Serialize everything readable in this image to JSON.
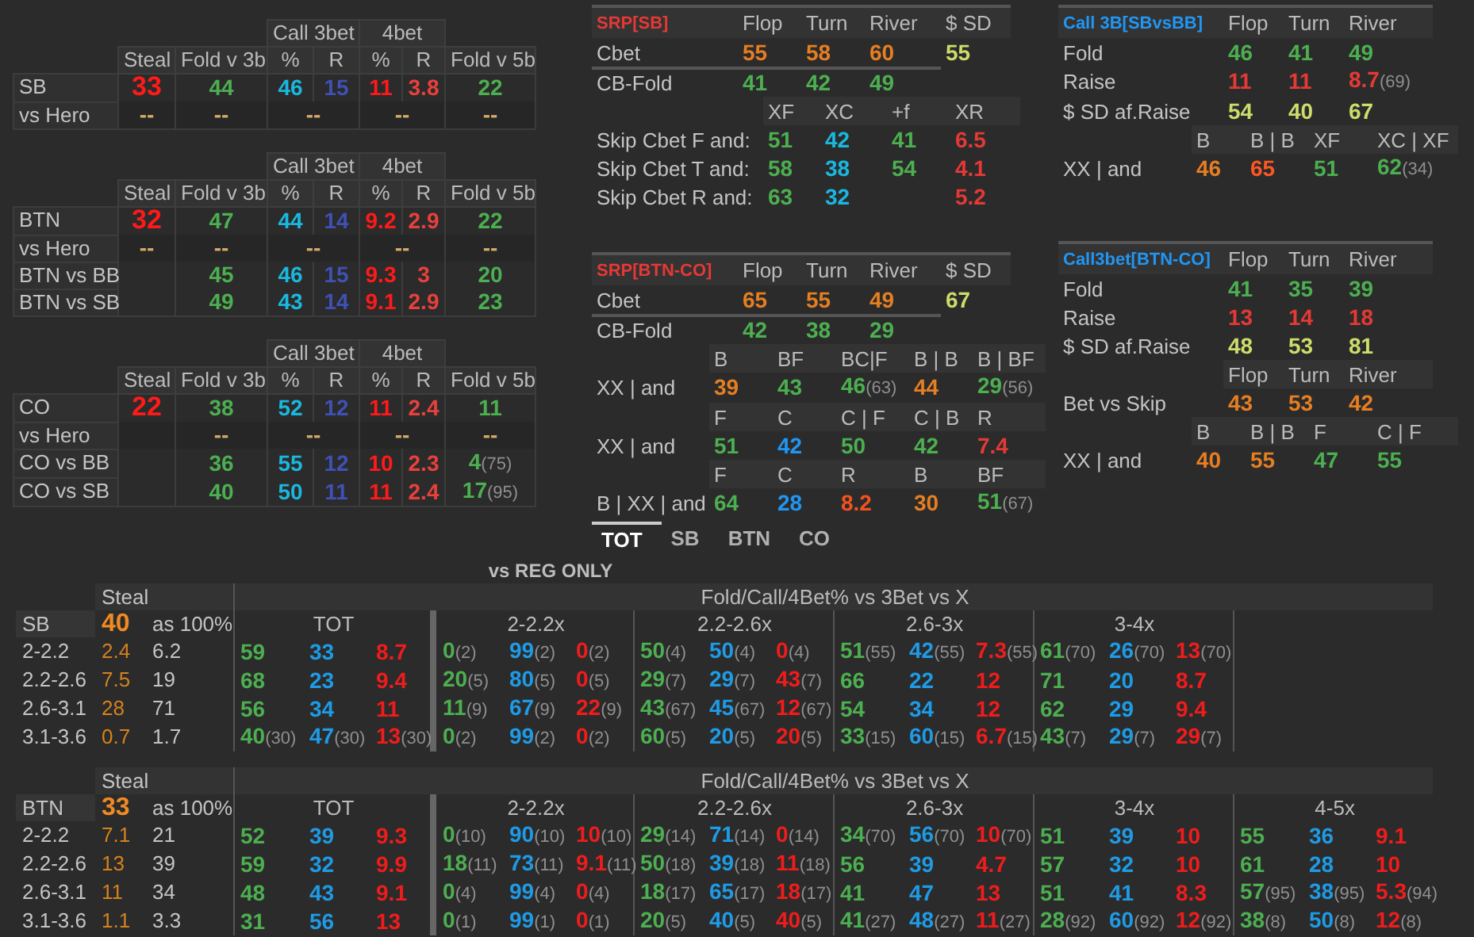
{
  "position_tables": [
    {
      "group_headers": [
        "Call 3bet",
        "4bet"
      ],
      "columns": [
        "Steal",
        "Fold v 3b",
        "%",
        "R",
        "%",
        "R",
        "Fold v 5b"
      ],
      "rows": [
        {
          "label": "SB",
          "kind": "full",
          "cells": [
            {
              "value": "33",
              "color": "#ff1a1a"
            },
            {
              "value": "44",
              "color": "#4caf50"
            },
            {
              "value": "46",
              "color": "#1ab8e0"
            },
            {
              "value": "15",
              "color": "#3f51b5"
            },
            {
              "value": "11",
              "color": "#ff1a1a"
            },
            {
              "value": "3.8",
              "color": "#e8403c"
            },
            {
              "value": "22",
              "color": "#4caf50"
            }
          ]
        },
        {
          "label": "vs Hero",
          "kind": "merged",
          "cells": [
            {
              "value": "--",
              "color": "#d4a96a"
            },
            {
              "value": "--",
              "color": "#d4a96a"
            },
            {
              "value": "--",
              "color": "#d4a96a",
              "colspan": 2
            },
            {
              "value": "--",
              "color": "#d4a96a",
              "colspan": 2
            },
            {
              "value": "--",
              "color": "#d4a96a"
            }
          ]
        }
      ]
    },
    {
      "group_headers": [
        "Call 3bet",
        "4bet"
      ],
      "columns": [
        "Steal",
        "Fold v 3b",
        "%",
        "R",
        "%",
        "R",
        "Fold v 5b"
      ],
      "rows": [
        {
          "label": "BTN",
          "kind": "full",
          "cells": [
            {
              "value": "32",
              "color": "#ff1a1a"
            },
            {
              "value": "47",
              "color": "#4caf50"
            },
            {
              "value": "44",
              "color": "#1ab8e0"
            },
            {
              "value": "14",
              "color": "#3f51b5"
            },
            {
              "value": "9.2",
              "color": "#ff1a1a"
            },
            {
              "value": "2.9",
              "color": "#e8403c"
            },
            {
              "value": "22",
              "color": "#4caf50"
            }
          ]
        },
        {
          "label": "vs Hero",
          "kind": "merged",
          "cells": [
            {
              "value": "--",
              "color": "#d4a96a"
            },
            {
              "value": "--",
              "color": "#d4a96a"
            },
            {
              "value": "--",
              "color": "#d4a96a",
              "colspan": 2
            },
            {
              "value": "--",
              "color": "#d4a96a",
              "colspan": 2
            },
            {
              "value": "--",
              "color": "#d4a96a"
            }
          ]
        },
        {
          "label": "BTN vs BB",
          "kind": "full",
          "cells": [
            null,
            {
              "value": "45",
              "color": "#4caf50"
            },
            {
              "value": "46",
              "color": "#1ab8e0"
            },
            {
              "value": "15",
              "color": "#3f51b5"
            },
            {
              "value": "9.3",
              "color": "#ff1a1a"
            },
            {
              "value": "3",
              "color": "#e8403c"
            },
            {
              "value": "20",
              "color": "#4caf50"
            }
          ]
        },
        {
          "label": "BTN vs SB",
          "kind": "full",
          "cells": [
            null,
            {
              "value": "49",
              "color": "#4caf50"
            },
            {
              "value": "43",
              "color": "#1ab8e0"
            },
            {
              "value": "14",
              "color": "#3f51b5"
            },
            {
              "value": "9.1",
              "color": "#ff1a1a"
            },
            {
              "value": "2.9",
              "color": "#e8403c"
            },
            {
              "value": "23",
              "color": "#4caf50"
            }
          ]
        }
      ]
    },
    {
      "group_headers": [
        "Call 3bet",
        "4bet"
      ],
      "columns": [
        "Steal",
        "Fold v 3b",
        "%",
        "R",
        "%",
        "R",
        "Fold v 5b"
      ],
      "rows": [
        {
          "label": "CO",
          "kind": "full",
          "cells": [
            {
              "value": "22",
              "color": "#ff1a1a"
            },
            {
              "value": "38",
              "color": "#4caf50"
            },
            {
              "value": "52",
              "color": "#1ab8e0"
            },
            {
              "value": "12",
              "color": "#3f51b5"
            },
            {
              "value": "11",
              "color": "#ff1a1a"
            },
            {
              "value": "2.4",
              "color": "#e8403c"
            },
            {
              "value": "11",
              "color": "#4caf50"
            }
          ]
        },
        {
          "label": "vs Hero",
          "kind": "merged",
          "cells": [
            null,
            {
              "value": "--",
              "color": "#d4a96a"
            },
            {
              "value": "--",
              "color": "#d4a96a",
              "colspan": 2
            },
            {
              "value": "--",
              "color": "#d4a96a",
              "colspan": 2
            },
            {
              "value": "--",
              "color": "#d4a96a"
            }
          ]
        },
        {
          "label": "CO vs BB",
          "kind": "full",
          "cells": [
            null,
            {
              "value": "36",
              "color": "#4caf50"
            },
            {
              "value": "55",
              "color": "#1ab8e0"
            },
            {
              "value": "12",
              "color": "#3f51b5"
            },
            {
              "value": "10",
              "color": "#ff1a1a"
            },
            {
              "value": "2.3",
              "color": "#e8403c"
            },
            {
              "value": "4",
              "sample": "(75)",
              "color": "#4caf50"
            }
          ]
        },
        {
          "label": "CO vs SB",
          "kind": "full",
          "cells": [
            null,
            {
              "value": "40",
              "color": "#4caf50"
            },
            {
              "value": "50",
              "color": "#1ab8e0"
            },
            {
              "value": "11",
              "color": "#3f51b5"
            },
            {
              "value": "11",
              "color": "#ff1a1a"
            },
            {
              "value": "2.4",
              "color": "#e8403c"
            },
            {
              "value": "17",
              "sample": "(95)",
              "color": "#4caf50"
            }
          ]
        }
      ]
    }
  ],
  "middle_panels": [
    {
      "title": "SRP[SB]",
      "color": "#e53935",
      "blocks": [
        {
          "kind": "main",
          "header": [
            "Flop",
            "Turn",
            "River",
            "$ SD"
          ],
          "rows": [
            {
              "label": "Cbet",
              "cells": [
                {
                  "value": "55",
                  "color": "#e67e22"
                },
                {
                  "value": "58",
                  "color": "#e67e22"
                },
                {
                  "value": "60",
                  "color": "#e67e22"
                },
                {
                  "value": "55",
                  "color": "#cddc6a"
                }
              ]
            }
          ]
        },
        {
          "kind": "main",
          "rows": [
            {
              "label": "CB-Fold",
              "cells": [
                {
                  "value": "41",
                  "color": "#4caf50"
                },
                {
                  "value": "42",
                  "color": "#4caf50"
                },
                {
                  "value": "49",
                  "color": "#4caf50"
                }
              ]
            }
          ]
        },
        {
          "kind": "wide",
          "header": [
            "XF",
            "XC",
            "+f",
            "XR"
          ],
          "rows": [
            {
              "label": "Skip Cbet F and:",
              "cells": [
                {
                  "value": "51",
                  "color": "#4caf50"
                },
                {
                  "value": "42",
                  "color": "#1ab8e0"
                },
                {
                  "value": "41",
                  "color": "#4caf50"
                },
                {
                  "value": "6.5",
                  "color": "#e53935"
                }
              ]
            },
            {
              "label": "Skip Cbet T and:",
              "cells": [
                {
                  "value": "58",
                  "color": "#4caf50"
                },
                {
                  "value": "38",
                  "color": "#1ab8e0"
                },
                {
                  "value": "54",
                  "color": "#4caf50"
                },
                {
                  "value": "4.1",
                  "color": "#e53935"
                }
              ]
            },
            {
              "label": "Skip Cbet R and:",
              "cells": [
                {
                  "value": "63",
                  "color": "#4caf50"
                },
                {
                  "value": "32",
                  "color": "#1ab8e0"
                },
                null,
                {
                  "value": "5.2",
                  "color": "#e53935"
                }
              ]
            }
          ]
        }
      ]
    },
    {
      "title": "SRP[BTN-CO]",
      "color": "#e53935",
      "blocks": [
        {
          "kind": "main",
          "header": [
            "Flop",
            "Turn",
            "River",
            "$ SD"
          ],
          "rows": [
            {
              "label": "Cbet",
              "cells": [
                {
                  "value": "65",
                  "color": "#e67e22"
                },
                {
                  "value": "55",
                  "color": "#e67e22"
                },
                {
                  "value": "49",
                  "color": "#e67e22"
                },
                {
                  "value": "67",
                  "color": "#cddc6a"
                }
              ]
            }
          ]
        },
        {
          "kind": "main",
          "rows": [
            {
              "label": "CB-Fold",
              "cells": [
                {
                  "value": "42",
                  "color": "#4caf50"
                },
                {
                  "value": "38",
                  "color": "#4caf50"
                },
                {
                  "value": "29",
                  "color": "#4caf50"
                }
              ]
            }
          ]
        },
        {
          "kind": "grid",
          "header": [
            "B",
            "BF",
            "BC|F",
            "B | B",
            "B | BF"
          ],
          "rows": [
            {
              "label": "XX | and",
              "cells": [
                {
                  "value": "39",
                  "color": "#e67e22"
                },
                {
                  "value": "43",
                  "color": "#4caf50"
                },
                {
                  "value": "46",
                  "sample": "(63)",
                  "color": "#4caf50"
                },
                {
                  "value": "44",
                  "color": "#e67e22"
                },
                {
                  "value": "29",
                  "sample": "(56)",
                  "color": "#4caf50"
                }
              ]
            }
          ]
        },
        {
          "kind": "grid",
          "header": [
            "F",
            "C",
            "C | F",
            "C | B",
            "R"
          ],
          "rows": [
            {
              "label": "XX | and",
              "cells": [
                {
                  "value": "51",
                  "color": "#4caf50"
                },
                {
                  "value": "42",
                  "color": "#2196f3"
                },
                {
                  "value": "50",
                  "color": "#4caf50"
                },
                {
                  "value": "42",
                  "color": "#4caf50"
                },
                {
                  "value": "7.4",
                  "color": "#e53935"
                }
              ]
            }
          ]
        },
        {
          "kind": "grid",
          "header": [
            "F",
            "C",
            "R",
            "B",
            "BF"
          ],
          "rows": [
            {
              "label": "B | XX | and",
              "cells": [
                {
                  "value": "64",
                  "color": "#4caf50"
                },
                {
                  "value": "28",
                  "color": "#2196f3"
                },
                {
                  "value": "8.2",
                  "color": "#f4511e"
                },
                {
                  "value": "30",
                  "color": "#e67e22"
                },
                {
                  "value": "51",
                  "sample": "(67)",
                  "color": "#4caf50"
                }
              ]
            }
          ]
        }
      ]
    }
  ],
  "tabs": [
    {
      "label": "TOT",
      "selected": true
    },
    {
      "label": "SB",
      "selected": false
    },
    {
      "label": "BTN",
      "selected": false
    },
    {
      "label": "CO",
      "selected": false
    }
  ],
  "right_panels": [
    {
      "title": "Call 3B[SBvsBB]",
      "color": "#2196f3",
      "blocks": [
        {
          "kind": "main",
          "header": [
            "Flop",
            "Turn",
            "River"
          ],
          "rows": [
            {
              "label": "Fold",
              "cells": [
                {
                  "value": "46",
                  "color": "#4caf50"
                },
                {
                  "value": "41",
                  "color": "#4caf50"
                },
                {
                  "value": "49",
                  "color": "#4caf50"
                }
              ]
            },
            {
              "label": "Raise",
              "cells": [
                {
                  "value": "11",
                  "color": "#e53935"
                },
                {
                  "value": "11",
                  "color": "#e53935"
                },
                {
                  "value": "8.7",
                  "sample": "(69)",
                  "color": "#e53935"
                }
              ]
            },
            {
              "label": "$ SD af.Raise",
              "cells": [
                {
                  "value": "54",
                  "color": "#cddc6a"
                },
                {
                  "value": "40",
                  "color": "#cddc6a"
                },
                {
                  "value": "67",
                  "color": "#cddc6a"
                }
              ]
            }
          ]
        },
        {
          "kind": "grid",
          "header": [
            "B",
            "B | B",
            "XF",
            "XC | XF"
          ],
          "rows": [
            {
              "label": "XX | and",
              "cells": [
                {
                  "value": "46",
                  "color": "#e67e22"
                },
                {
                  "value": "65",
                  "color": "#ff5722"
                },
                {
                  "value": "51",
                  "color": "#4caf50"
                },
                {
                  "value": "62",
                  "sample": "(34)",
                  "color": "#4caf50"
                }
              ]
            }
          ]
        }
      ]
    },
    {
      "title": "Call3bet[BTN-CO]",
      "color": "#2196f3",
      "blocks": [
        {
          "kind": "main",
          "header": [
            "Flop",
            "Turn",
            "River"
          ],
          "rows": [
            {
              "label": "Fold",
              "cells": [
                {
                  "value": "41",
                  "color": "#4caf50"
                },
                {
                  "value": "35",
                  "color": "#4caf50"
                },
                {
                  "value": "39",
                  "color": "#4caf50"
                }
              ]
            },
            {
              "label": "Raise",
              "cells": [
                {
                  "value": "13",
                  "color": "#e53935"
                },
                {
                  "value": "14",
                  "color": "#e53935"
                },
                {
                  "value": "18",
                  "color": "#e53935"
                }
              ]
            },
            {
              "label": "$ SD af.Raise",
              "cells": [
                {
                  "value": "48",
                  "color": "#cddc6a"
                },
                {
                  "value": "53",
                  "color": "#cddc6a"
                },
                {
                  "value": "81",
                  "color": "#cddc6a"
                }
              ]
            }
          ]
        },
        {
          "kind": "main",
          "header": [
            "Flop",
            "Turn",
            "River"
          ],
          "rows": [
            {
              "label": "Bet vs Skip",
              "cells": [
                {
                  "value": "43",
                  "color": "#e67e22"
                },
                {
                  "value": "53",
                  "color": "#e67e22"
                },
                {
                  "value": "42",
                  "color": "#e67e22"
                }
              ]
            }
          ]
        },
        {
          "kind": "grid",
          "header": [
            "B",
            "B | B",
            "F",
            "C | F"
          ],
          "rows": [
            {
              "label": "XX | and",
              "cells": [
                {
                  "value": "40",
                  "color": "#e67e22"
                },
                {
                  "value": "55",
                  "color": "#e67e22"
                },
                {
                  "value": "47",
                  "color": "#4caf50"
                },
                {
                  "value": "55",
                  "color": "#4caf50"
                }
              ]
            }
          ]
        }
      ]
    }
  ],
  "reg_section": {
    "title": "vs REG ONLY",
    "blocks": [
      {
        "position": "SB",
        "steal_header": "Steal",
        "steal": "40",
        "as100": "as 100%",
        "header": "Fold/Call/4Bet% vs 3Bet vs X",
        "groups": [
          "TOT",
          "2-2.2x",
          "2.2-2.6x",
          "2.6-3x",
          "3-4x"
        ],
        "rows": [
          {
            "label": "2-2.2",
            "steal": "2.4",
            "as100": "6.2",
            "cells": [
              [
                "59"
              ],
              [
                "33"
              ],
              [
                "8.7"
              ],
              [
                "0",
                "(2)"
              ],
              [
                "99",
                "(2)"
              ],
              [
                "0",
                "(2)"
              ],
              [
                "50",
                "(4)"
              ],
              [
                "50",
                "(4)"
              ],
              [
                "0",
                "(4)"
              ],
              [
                "51",
                "(55)"
              ],
              [
                "42",
                "(55)"
              ],
              [
                "7.3",
                "(55)"
              ],
              [
                "61",
                "(70)"
              ],
              [
                "26",
                "(70)"
              ],
              [
                "13",
                "(70)"
              ]
            ]
          },
          {
            "label": "2.2-2.6",
            "steal": "7.5",
            "as100": "19",
            "cells": [
              [
                "68"
              ],
              [
                "23"
              ],
              [
                "9.4"
              ],
              [
                "20",
                "(5)"
              ],
              [
                "80",
                "(5)"
              ],
              [
                "0",
                "(5)"
              ],
              [
                "29",
                "(7)"
              ],
              [
                "29",
                "(7)"
              ],
              [
                "43",
                "(7)"
              ],
              [
                "66"
              ],
              [
                "22"
              ],
              [
                "12"
              ],
              [
                "71"
              ],
              [
                "20"
              ],
              [
                "8.7"
              ]
            ]
          },
          {
            "label": "2.6-3.1",
            "steal": "28",
            "as100": "71",
            "cells": [
              [
                "56"
              ],
              [
                "34"
              ],
              [
                "11"
              ],
              [
                "11",
                "(9)"
              ],
              [
                "67",
                "(9)"
              ],
              [
                "22",
                "(9)"
              ],
              [
                "43",
                "(67)"
              ],
              [
                "45",
                "(67)"
              ],
              [
                "12",
                "(67)"
              ],
              [
                "54"
              ],
              [
                "34"
              ],
              [
                "12"
              ],
              [
                "62"
              ],
              [
                "29"
              ],
              [
                "9.4"
              ]
            ]
          },
          {
            "label": "3.1-3.6",
            "steal": "0.7",
            "as100": "1.7",
            "cells": [
              [
                "40",
                "(30)"
              ],
              [
                "47",
                "(30)"
              ],
              [
                "13",
                "(30)"
              ],
              [
                "0",
                "(2)"
              ],
              [
                "99",
                "(2)"
              ],
              [
                "0",
                "(2)"
              ],
              [
                "60",
                "(5)"
              ],
              [
                "20",
                "(5)"
              ],
              [
                "20",
                "(5)"
              ],
              [
                "33",
                "(15)"
              ],
              [
                "60",
                "(15)"
              ],
              [
                "6.7",
                "(15)"
              ],
              [
                "43",
                "(7)"
              ],
              [
                "29",
                "(7)"
              ],
              [
                "29",
                "(7)"
              ]
            ]
          }
        ]
      },
      {
        "position": "BTN",
        "steal_header": "Steal",
        "steal": "33",
        "as100": "as 100%",
        "header": "Fold/Call/4Bet% vs 3Bet vs X",
        "groups": [
          "TOT",
          "2-2.2x",
          "2.2-2.6x",
          "2.6-3x",
          "3-4x",
          "4-5x"
        ],
        "rows": [
          {
            "label": "2-2.2",
            "steal": "7.1",
            "as100": "21",
            "cells": [
              [
                "52"
              ],
              [
                "39"
              ],
              [
                "9.3"
              ],
              [
                "0",
                "(10)"
              ],
              [
                "90",
                "(10)"
              ],
              [
                "10",
                "(10)"
              ],
              [
                "29",
                "(14)"
              ],
              [
                "71",
                "(14)"
              ],
              [
                "0",
                "(14)"
              ],
              [
                "34",
                "(70)"
              ],
              [
                "56",
                "(70)"
              ],
              [
                "10",
                "(70)"
              ],
              [
                "51"
              ],
              [
                "39"
              ],
              [
                "10"
              ],
              [
                "55"
              ],
              [
                "36"
              ],
              [
                "9.1"
              ]
            ]
          },
          {
            "label": "2.2-2.6",
            "steal": "13",
            "as100": "39",
            "cells": [
              [
                "59"
              ],
              [
                "32"
              ],
              [
                "9.9"
              ],
              [
                "18",
                "(11)"
              ],
              [
                "73",
                "(11)"
              ],
              [
                "9.1",
                "(11)"
              ],
              [
                "50",
                "(18)"
              ],
              [
                "39",
                "(18)"
              ],
              [
                "11",
                "(18)"
              ],
              [
                "56"
              ],
              [
                "39"
              ],
              [
                "4.7"
              ],
              [
                "57"
              ],
              [
                "32"
              ],
              [
                "10"
              ],
              [
                "61"
              ],
              [
                "28"
              ],
              [
                "10"
              ]
            ]
          },
          {
            "label": "2.6-3.1",
            "steal": "11",
            "as100": "34",
            "cells": [
              [
                "48"
              ],
              [
                "43"
              ],
              [
                "9.1"
              ],
              [
                "0",
                "(4)"
              ],
              [
                "99",
                "(4)"
              ],
              [
                "0",
                "(4)"
              ],
              [
                "18",
                "(17)"
              ],
              [
                "65",
                "(17)"
              ],
              [
                "18",
                "(17)"
              ],
              [
                "41"
              ],
              [
                "47"
              ],
              [
                "13"
              ],
              [
                "51"
              ],
              [
                "41"
              ],
              [
                "8.3"
              ],
              [
                "57",
                "(95)"
              ],
              [
                "38",
                "(95)"
              ],
              [
                "5.3",
                "(94)"
              ]
            ]
          },
          {
            "label": "3.1-3.6",
            "steal": "1.1",
            "as100": "3.3",
            "cells": [
              [
                "31"
              ],
              [
                "56"
              ],
              [
                "13"
              ],
              [
                "0",
                "(1)"
              ],
              [
                "99",
                "(1)"
              ],
              [
                "0",
                "(1)"
              ],
              [
                "20",
                "(5)"
              ],
              [
                "40",
                "(5)"
              ],
              [
                "40",
                "(5)"
              ],
              [
                "41",
                "(27)"
              ],
              [
                "48",
                "(27)"
              ],
              [
                "11",
                "(27)"
              ],
              [
                "28",
                "(92)"
              ],
              [
                "60",
                "(92)"
              ],
              [
                "12",
                "(92)"
              ],
              [
                "38",
                "(8)"
              ],
              [
                "50",
                "(8)"
              ],
              [
                "12",
                "(8)"
              ]
            ]
          }
        ]
      }
    ]
  }
}
